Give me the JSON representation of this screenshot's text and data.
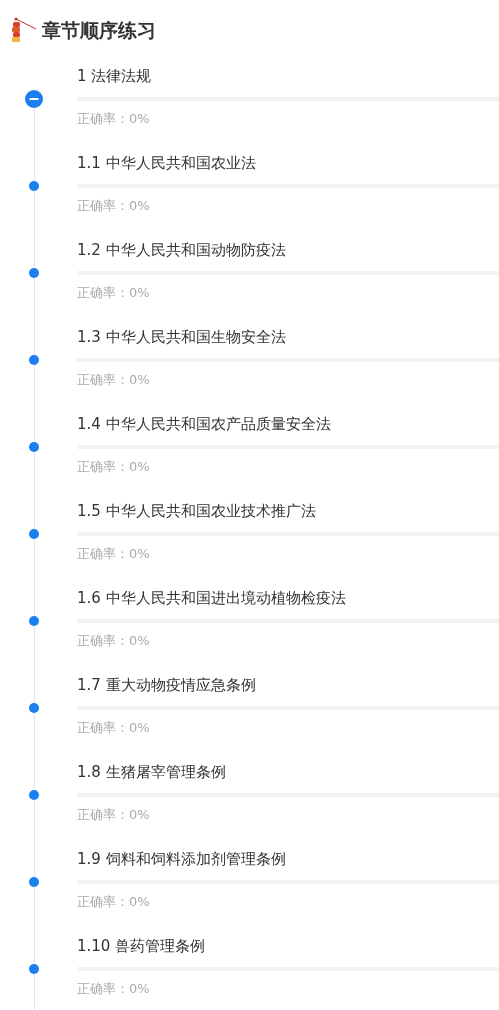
{
  "title": "章节顺序练习",
  "chapters": [
    {
      "title": "1 法律法规",
      "accuracy": "正确率：0%",
      "level": 0,
      "expanded": true,
      "children": [
        {
          "title": "1.1 中华人民共和国农业法",
          "accuracy": "正确率：0%",
          "level": 0
        },
        {
          "title": "1.2 中华人民共和国动物防疫法",
          "accuracy": "正确率：0%",
          "level": 0
        },
        {
          "title": "1.3 中华人民共和国生物安全法",
          "accuracy": "正确率：0%",
          "level": 0
        },
        {
          "title": "1.4 中华人民共和国农产品质量安全法",
          "accuracy": "正确率：0%",
          "level": 0
        },
        {
          "title": "1.5 中华人民共和国农业技术推广法",
          "accuracy": "正确率：0%",
          "level": 0
        },
        {
          "title": "1.6 中华人民共和国进出境动植物检疫法",
          "accuracy": "正确率：0%",
          "level": 0
        },
        {
          "title": "1.7 重大动物疫情应急条例",
          "accuracy": "正确率：0%",
          "level": 0
        },
        {
          "title": "1.8 生猪屠宰管理条例",
          "accuracy": "正确率：0%",
          "level": 0
        },
        {
          "title": "1.9 饲料和饲料添加剂管理条例",
          "accuracy": "正确率：0%",
          "level": 0
        },
        {
          "title": "1.10 兽药管理条例",
          "accuracy": "正确率：0%",
          "level": 0
        }
      ]
    }
  ]
}
